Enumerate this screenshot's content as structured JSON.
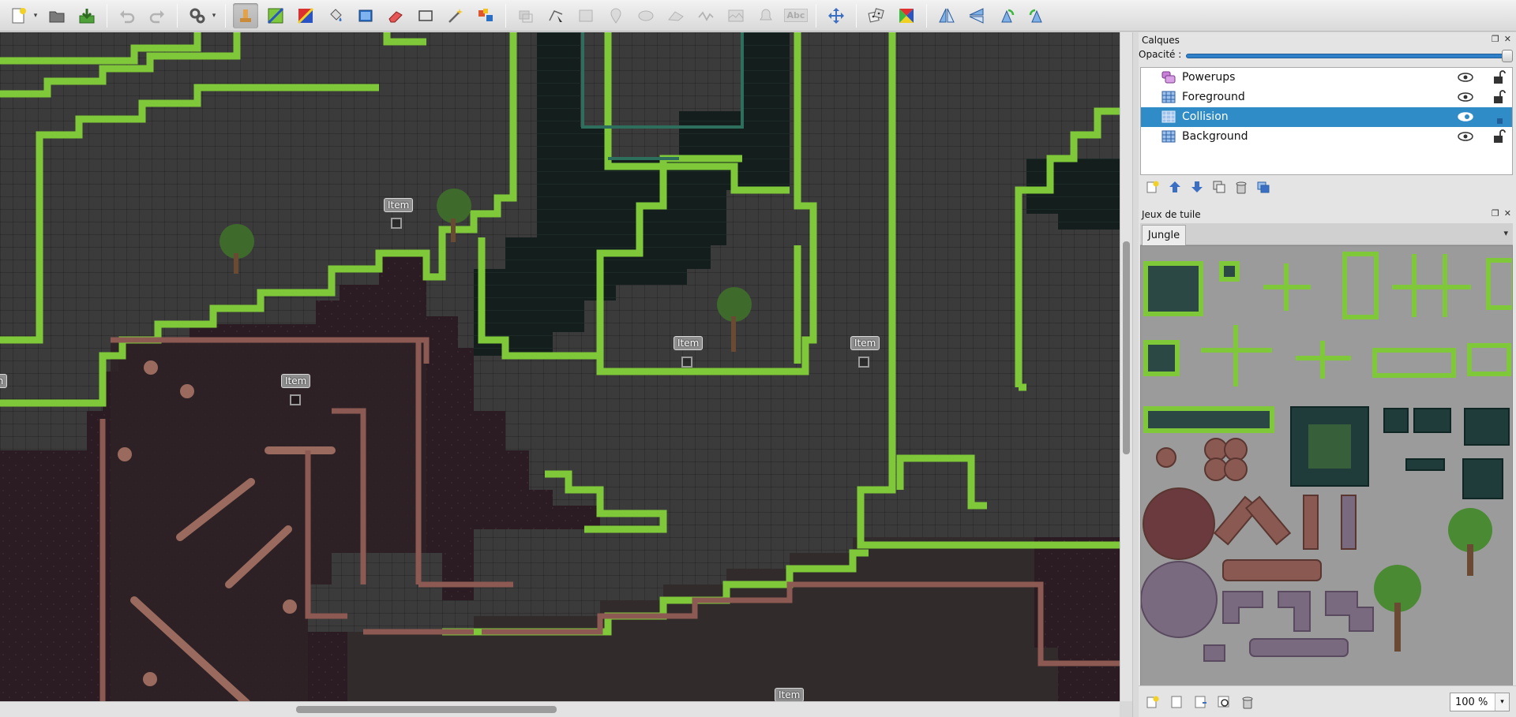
{
  "toolbar": {
    "buttons": [
      "new-icon",
      "open-icon",
      "save-icon",
      "undo-icon",
      "redo-icon",
      "commands-icon",
      "stamp-icon",
      "terrain-icon",
      "wang-icon",
      "fill-icon",
      "shape-fill-icon",
      "eraser-icon",
      "rect-select-icon",
      "magic-wand-icon",
      "select-same-icon",
      "select-objects-icon",
      "edit-polygons-icon",
      "rectangle-icon",
      "point-icon",
      "ellipse-icon",
      "polygon-icon",
      "polyline-icon",
      "tile-object-icon",
      "template-icon",
      "text-icon",
      "random-mode-icon",
      "dice-icon",
      "wang-mode-icon",
      "flip-h-icon",
      "flip-v-icon",
      "rotate-left-icon",
      "rotate-right-icon"
    ],
    "text_tool_label": "Abc"
  },
  "map": {
    "item_labels": [
      "Item",
      "Item",
      "Item",
      "Item",
      "Item",
      "Item"
    ]
  },
  "layers_panel": {
    "title": "Calques",
    "opacity_label": "Opacité :",
    "opacity": 1.0,
    "layers": [
      {
        "name": "Powerups",
        "type": "object",
        "visible": true,
        "locked": false,
        "selected": false
      },
      {
        "name": "Foreground",
        "type": "tile",
        "visible": true,
        "locked": false,
        "selected": false
      },
      {
        "name": "Collision",
        "type": "tile",
        "visible": true,
        "locked": false,
        "selected": true
      },
      {
        "name": "Background",
        "type": "tile",
        "visible": true,
        "locked": false,
        "selected": false
      }
    ]
  },
  "tilesets_panel": {
    "title": "Jeux de tuile",
    "tabs": [
      "Jungle"
    ],
    "active_tab": "Jungle"
  },
  "zoom": {
    "value": "100 %"
  },
  "colors": {
    "selection": "#308cc6",
    "grass": "#7ec83a",
    "rock": "#8a5a56",
    "map_bg": "#3c3b3b"
  }
}
